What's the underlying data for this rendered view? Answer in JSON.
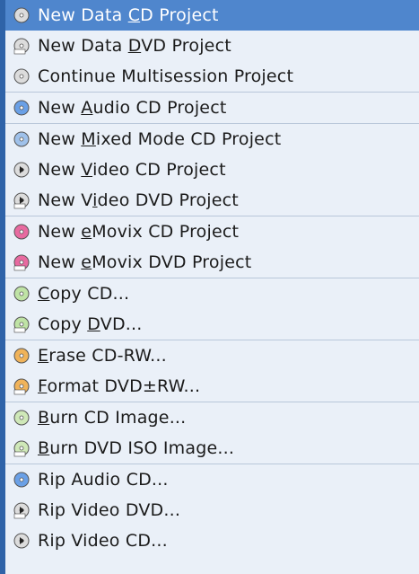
{
  "menu": {
    "items": [
      {
        "label": "New Data CD Project",
        "mnemonic_index": 9,
        "icon": "cd-data-icon",
        "active": true,
        "sep": false
      },
      {
        "label": "New Data DVD Project",
        "mnemonic_index": 9,
        "icon": "dvd-data-icon",
        "active": false,
        "sep": false
      },
      {
        "label": "Continue Multisession Project",
        "mnemonic_index": -1,
        "icon": "cd-multisession-icon",
        "active": false,
        "sep": true
      },
      {
        "label": "New Audio CD Project",
        "mnemonic_index": 4,
        "icon": "cd-audio-icon",
        "active": false,
        "sep": true
      },
      {
        "label": "New Mixed Mode CD Project",
        "mnemonic_index": 4,
        "icon": "cd-mixed-icon",
        "active": false,
        "sep": false
      },
      {
        "label": "New Video CD Project",
        "mnemonic_index": 4,
        "icon": "video-cd-icon",
        "active": false,
        "sep": false
      },
      {
        "label": "New Video DVD Project",
        "mnemonic_index": 5,
        "icon": "video-dvd-icon",
        "active": false,
        "sep": true
      },
      {
        "label": "New eMovix CD Project",
        "mnemonic_index": 4,
        "icon": "emovix-cd-icon",
        "active": false,
        "sep": false
      },
      {
        "label": "New eMovix DVD Project",
        "mnemonic_index": 4,
        "icon": "emovix-dvd-icon",
        "active": false,
        "sep": true
      },
      {
        "label": "Copy CD...",
        "mnemonic_index": 0,
        "icon": "copy-cd-icon",
        "active": false,
        "sep": false
      },
      {
        "label": "Copy DVD...",
        "mnemonic_index": 5,
        "icon": "copy-dvd-icon",
        "active": false,
        "sep": true
      },
      {
        "label": "Erase CD-RW...",
        "mnemonic_index": 0,
        "icon": "erase-cdrw-icon",
        "active": false,
        "sep": false
      },
      {
        "label": "Format DVD±RW...",
        "mnemonic_index": 0,
        "icon": "format-dvd-icon",
        "active": false,
        "sep": true
      },
      {
        "label": "Burn CD Image...",
        "mnemonic_index": 0,
        "icon": "burn-cd-image-icon",
        "active": false,
        "sep": false
      },
      {
        "label": "Burn DVD ISO Image...",
        "mnemonic_index": 0,
        "icon": "burn-dvd-iso-icon",
        "active": false,
        "sep": true
      },
      {
        "label": "Rip Audio CD...",
        "mnemonic_index": -1,
        "icon": "rip-audio-cd-icon",
        "active": false,
        "sep": false
      },
      {
        "label": "Rip Video DVD...",
        "mnemonic_index": -1,
        "icon": "rip-video-dvd-icon",
        "active": false,
        "sep": false
      },
      {
        "label": "Rip Video CD...",
        "mnemonic_index": -1,
        "icon": "rip-video-cd-icon",
        "active": false,
        "sep": false
      }
    ]
  },
  "colors": {
    "menu_bg": "#eaf0f8",
    "highlight": "#4f86cd",
    "left_border": "#2f63a8"
  }
}
